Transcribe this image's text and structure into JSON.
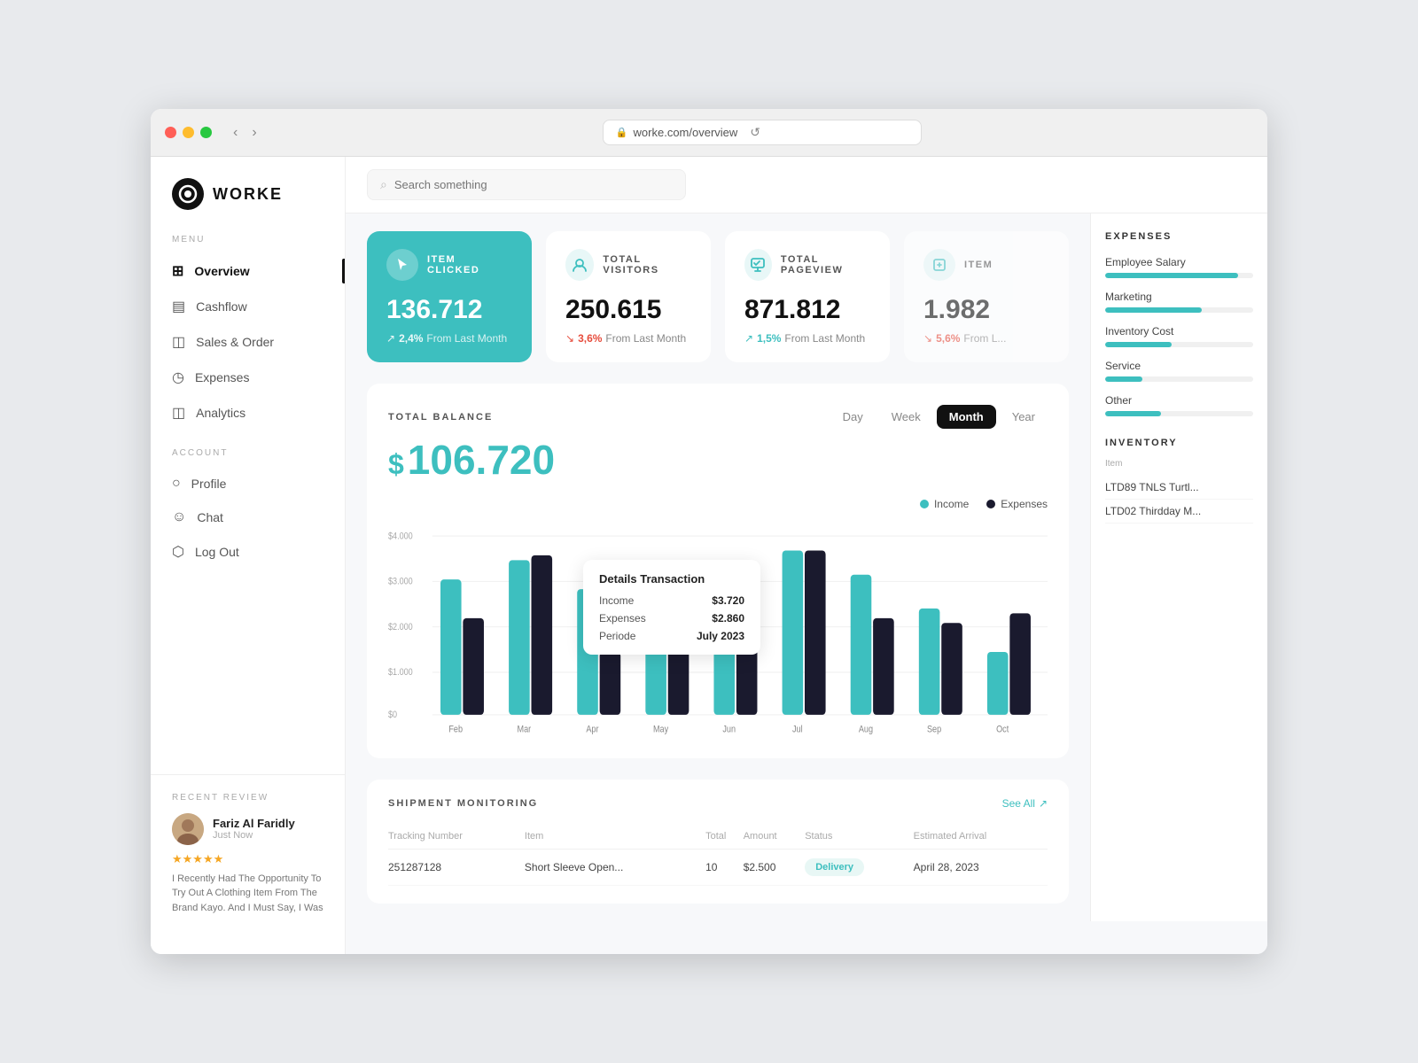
{
  "browser": {
    "url": "worke.com/overview",
    "back_label": "‹",
    "forward_label": "›",
    "reload_label": "↺"
  },
  "logo": {
    "text": "WORKE",
    "icon": "○"
  },
  "sidebar": {
    "menu_label": "MENU",
    "account_label": "ACCOUNT",
    "items": [
      {
        "id": "overview",
        "label": "Overview",
        "active": true
      },
      {
        "id": "cashflow",
        "label": "Cashflow",
        "active": false
      },
      {
        "id": "sales-order",
        "label": "Sales & Order",
        "active": false
      },
      {
        "id": "expenses",
        "label": "Expenses",
        "active": false
      },
      {
        "id": "analytics",
        "label": "Analytics",
        "active": false
      }
    ],
    "account_items": [
      {
        "id": "profile",
        "label": "Profile",
        "active": false
      },
      {
        "id": "chat",
        "label": "Chat",
        "active": false
      },
      {
        "id": "logout",
        "label": "Log Out",
        "active": false
      }
    ]
  },
  "recent_review": {
    "section_label": "RECENT REVIEW",
    "reviewer_name": "Fariz Al Faridly",
    "reviewer_time": "Just Now",
    "stars": "★★★★★",
    "review_text": "I Recently Had The Opportunity To Try Out A Clothing Item From The Brand Kayo. And I Must Say, I Was"
  },
  "search": {
    "placeholder": "Search something"
  },
  "stat_cards": [
    {
      "id": "item-clicked",
      "label": "ITEM CLICKED",
      "value": "136.712",
      "change": "2,4%",
      "direction": "up",
      "change_label": "From Last Month",
      "accent": true
    },
    {
      "id": "total-visitors",
      "label": "TOTAL VISITORS",
      "value": "250.615",
      "change": "3,6%",
      "direction": "down",
      "change_label": "From Last Month",
      "accent": false
    },
    {
      "id": "total-pageview",
      "label": "TOTAL PAGEVIEW",
      "value": "871.812",
      "change": "1,5%",
      "direction": "up",
      "change_label": "From Last Month",
      "accent": false
    },
    {
      "id": "item-4",
      "label": "ITEM",
      "value": "1.982",
      "change": "5,6%",
      "direction": "down",
      "change_label": "From L...",
      "accent": false
    }
  ],
  "balance": {
    "title": "TOTAL BALANCE",
    "amount": "106.720",
    "dollar_sign": "$",
    "period_tabs": [
      "Day",
      "Week",
      "Month",
      "Year"
    ],
    "active_tab": "Month",
    "legend": [
      {
        "label": "Income",
        "color": "#3dbfbf"
      },
      {
        "label": "Expenses",
        "color": "#1a1a2e"
      }
    ]
  },
  "chart": {
    "y_labels": [
      "$4.000",
      "$3.000",
      "$2.000",
      "$1.000",
      "$0"
    ],
    "months": [
      "Feb",
      "Mar",
      "Apr",
      "May",
      "Jun",
      "Jul",
      "Aug",
      "Sep",
      "Oct"
    ],
    "income": [
      2800,
      3200,
      2600,
      1700,
      2600,
      3400,
      2900,
      2200,
      1300
    ],
    "expenses": [
      2000,
      3300,
      1300,
      1400,
      2000,
      3400,
      2000,
      1900,
      2100
    ]
  },
  "tooltip": {
    "title": "Details Transaction",
    "income_label": "Income",
    "income_value": "$3.720",
    "expenses_label": "Expenses",
    "expenses_value": "$2.860",
    "period_label": "Periode",
    "period_value": "July 2023"
  },
  "shipment": {
    "title": "SHIPMENT MONITORING",
    "see_all": "See All",
    "columns": [
      "Tracking Number",
      "Item",
      "Total",
      "Amount",
      "Status",
      "Estimated Arrival"
    ],
    "rows": [
      {
        "tracking": "251287128",
        "item": "Short Sleeve Open...",
        "total": "10",
        "amount": "$2.500",
        "status": "Delivery",
        "status_type": "delivery",
        "arrival": "April 28, 2023"
      }
    ]
  },
  "expenses_panel": {
    "title": "EXPENSES",
    "items": [
      {
        "label": "Employee Salary",
        "pct": 90
      },
      {
        "label": "Marketing",
        "pct": 65
      },
      {
        "label": "Inventory Cost",
        "pct": 45
      },
      {
        "label": "Service",
        "pct": 25
      },
      {
        "label": "Other",
        "pct": 38
      }
    ]
  },
  "inventory_panel": {
    "title": "INVENTORY",
    "col_header": "Item",
    "items": [
      "LTD89 TNLS Turtl...",
      "LTD02 Thirdday M..."
    ]
  }
}
